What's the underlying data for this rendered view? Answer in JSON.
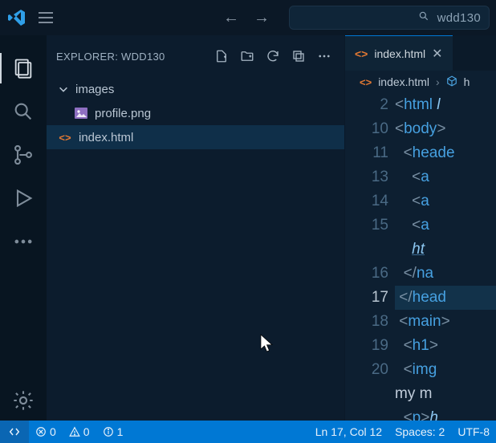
{
  "titlebar": {
    "search_text": "wdd130"
  },
  "sidebar": {
    "title": "EXPLORER: WDD130",
    "items": [
      {
        "label": "images",
        "kind": "folder",
        "depth": 1,
        "expanded": true
      },
      {
        "label": "profile.png",
        "kind": "image",
        "depth": 2
      },
      {
        "label": "index.html",
        "kind": "html",
        "depth": 1,
        "selected": true
      }
    ]
  },
  "editor": {
    "tab": {
      "label": "index.html"
    },
    "breadcrumb": [
      {
        "label": "index.html",
        "icon": "html"
      },
      {
        "label": "h",
        "icon": "cube",
        "partial": true
      }
    ],
    "lines": [
      {
        "num": 2,
        "html": "<html l"
      },
      {
        "num": 10,
        "html": "<body>"
      },
      {
        "num": 11,
        "html": "  <heade"
      },
      {
        "num": 13,
        "html": "    <a"
      },
      {
        "num": 14,
        "html": "    <a"
      },
      {
        "num": 15,
        "html": "    <a"
      },
      {
        "num": 0,
        "html": "    ht",
        "underline": true
      },
      {
        "num": 16,
        "html": "  </na"
      },
      {
        "num": 17,
        "html": " </head",
        "current": true
      },
      {
        "num": 18,
        "html": " <main>"
      },
      {
        "num": 19,
        "html": "  <h1>"
      },
      {
        "num": 20,
        "html": "  <img"
      },
      {
        "num": 0,
        "html": "my m",
        "text_only": true
      },
      {
        "num": 0,
        "html": "  <p>h",
        "cutoff": true
      }
    ]
  },
  "statusbar": {
    "errors": "0",
    "warnings": "0",
    "info": "1",
    "ln_col": "Ln 17, Col 12",
    "spaces": "Spaces: 2",
    "encoding": "UTF-8"
  }
}
